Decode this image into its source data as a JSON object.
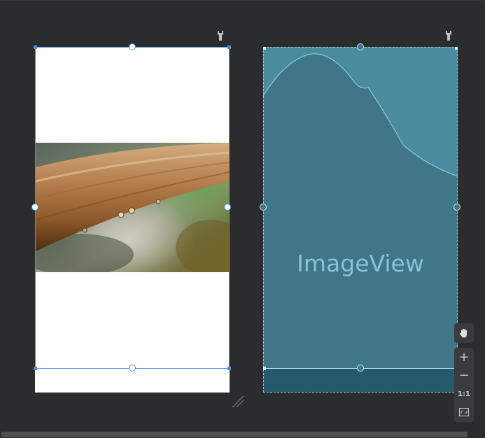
{
  "blueprint": {
    "widget_label": "ImageView"
  },
  "zoom_controls": {
    "pan_icon": "hand-icon",
    "zoom_in_label": "+",
    "zoom_out_label": "−",
    "actual_size_label": "1:1",
    "fit_icon": "fit-screen-icon"
  },
  "icons": {
    "design_options": "wrench-icon",
    "blueprint_options": "wrench-icon",
    "resize": "resize-grip-icon"
  },
  "colors": {
    "canvas_background": "#2b2c2e",
    "selection_blue": "#4a8fe0",
    "blueprint_fill": "#3f7688",
    "blueprint_footer": "#235a6c",
    "blueprint_text": "#86c3d7"
  }
}
